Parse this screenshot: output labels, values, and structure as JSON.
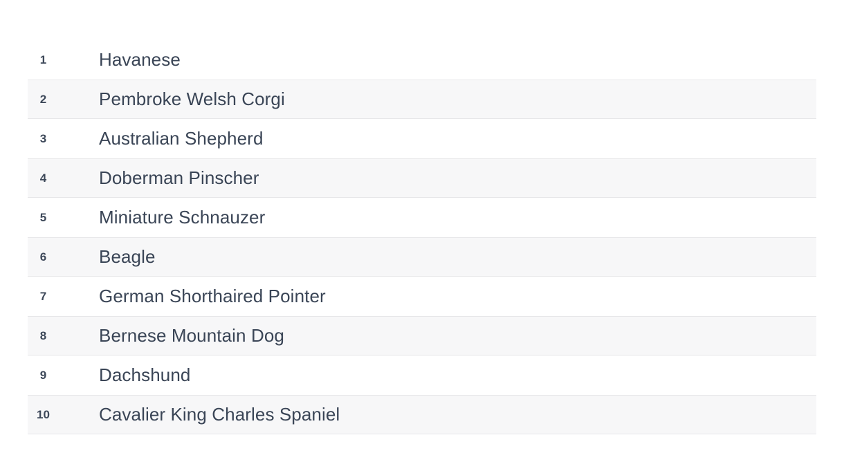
{
  "list": {
    "colors": {
      "text": "#3a4556",
      "rank_text": "#3d4859",
      "stripe_bg": "#f7f7f8",
      "row_border": "#e7e7e9",
      "page_bg": "#ffffff"
    },
    "rows": [
      {
        "rank": "1",
        "name": "Havanese"
      },
      {
        "rank": "2",
        "name": "Pembroke Welsh Corgi"
      },
      {
        "rank": "3",
        "name": "Australian Shepherd"
      },
      {
        "rank": "4",
        "name": "Doberman Pinscher"
      },
      {
        "rank": "5",
        "name": "Miniature Schnauzer"
      },
      {
        "rank": "6",
        "name": "Beagle"
      },
      {
        "rank": "7",
        "name": "German Shorthaired Pointer"
      },
      {
        "rank": "8",
        "name": "Bernese Mountain Dog"
      },
      {
        "rank": "9",
        "name": "Dachshund"
      },
      {
        "rank": "10",
        "name": "Cavalier King Charles Spaniel"
      }
    ]
  }
}
